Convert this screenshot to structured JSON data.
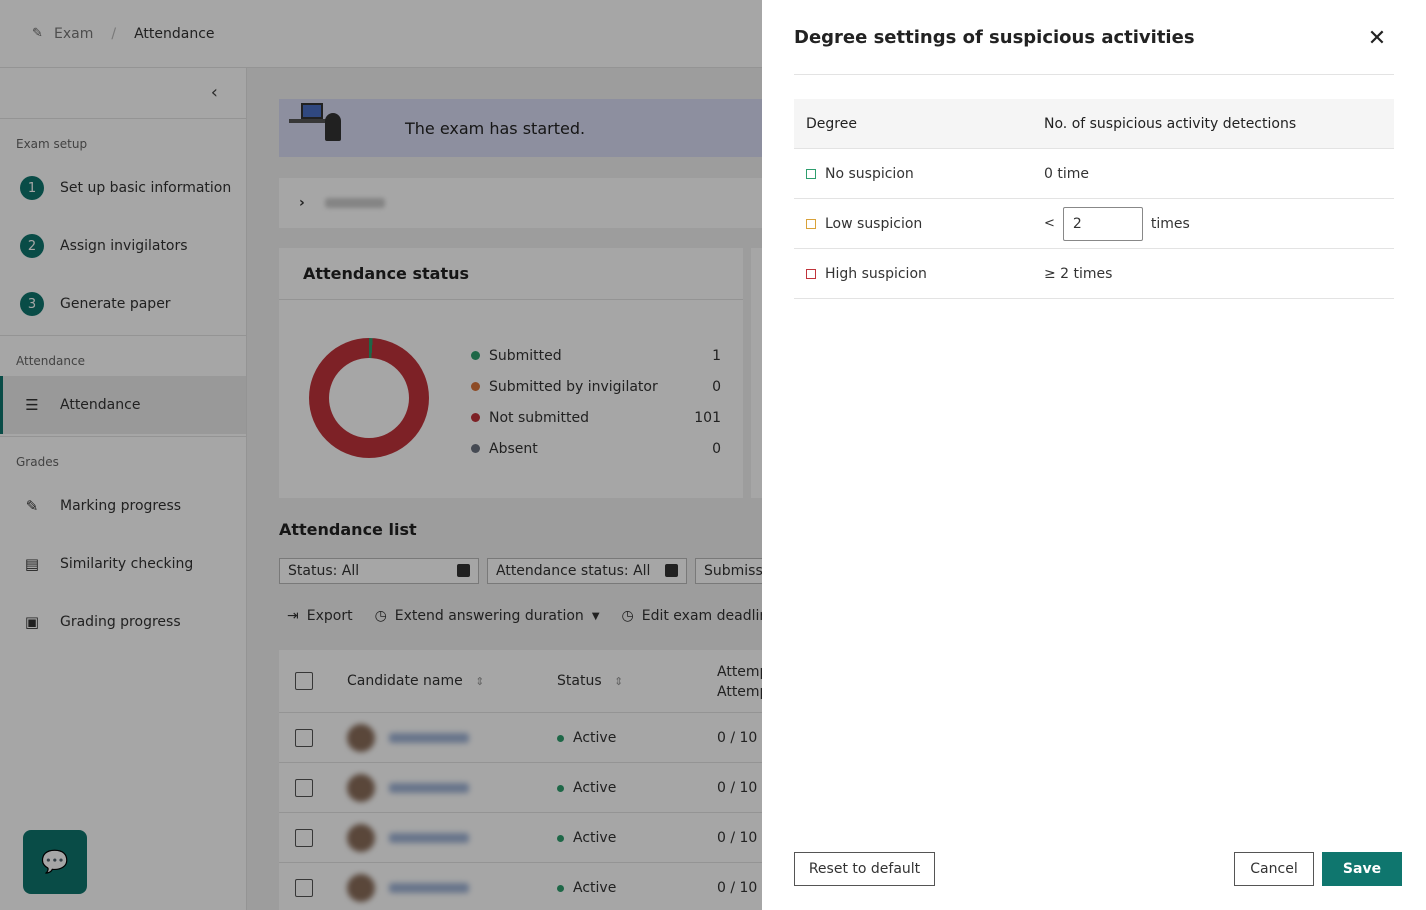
{
  "breadcrumb": {
    "first": "Exam",
    "current": "Attendance",
    "separator": "/"
  },
  "sidebar": {
    "sections": [
      {
        "label": "Exam setup"
      },
      {
        "label": "Attendance"
      },
      {
        "label": "Grades"
      }
    ],
    "setup_items": [
      {
        "num": "1",
        "label": "Set up basic information"
      },
      {
        "num": "2",
        "label": "Assign invigilators"
      },
      {
        "num": "3",
        "label": "Generate paper"
      }
    ],
    "attendance_item": {
      "label": "Attendance",
      "icon": "list-icon"
    },
    "grade_items": [
      {
        "label": "Marking progress",
        "icon": "pencil-icon"
      },
      {
        "label": "Similarity checking",
        "icon": "clipboard-icon"
      },
      {
        "label": "Grading progress",
        "icon": "grade-document-icon"
      }
    ]
  },
  "banner": {
    "text": "The exam has started."
  },
  "attendance_status": {
    "title": "Attendance status",
    "legend": [
      {
        "label": "Submitted",
        "value": "1",
        "color": "#2e9e6e"
      },
      {
        "label": "Submitted by invigilator",
        "value": "0",
        "color": "#d9733a"
      },
      {
        "label": "Not submitted",
        "value": "101",
        "color": "#c0343b"
      },
      {
        "label": "Absent",
        "value": "0",
        "color": "#6b7280"
      }
    ]
  },
  "attendance_list": {
    "title": "Attendance list",
    "filters": [
      "Status: All",
      "Attendance status: All",
      "Submissi"
    ],
    "toolbar": [
      "Export",
      "Extend answering duration",
      "Edit exam deadline"
    ],
    "columns": {
      "name": "Candidate name",
      "status": "Status",
      "attempts_line1": "Attemp",
      "attempts_line2": "Attemp"
    },
    "rows": [
      {
        "status": "Active",
        "attempts": "0 / 10"
      },
      {
        "status": "Active",
        "attempts": "0 / 10"
      },
      {
        "status": "Active",
        "attempts": "0 / 10"
      },
      {
        "status": "Active",
        "attempts": "0 / 10"
      }
    ]
  },
  "drawer": {
    "title": "Degree settings of suspicious activities",
    "columns": {
      "degree": "Degree",
      "detections": "No. of suspicious activity detections"
    },
    "rows": {
      "none": {
        "label": "No suspicion",
        "value": "0 time",
        "color": "#2e9e6e"
      },
      "low": {
        "label": "Low suspicion",
        "prefix": "<",
        "input_value": "2",
        "unit": "times",
        "color": "#d9a23a"
      },
      "high": {
        "label": "High suspicion",
        "value": "≥ 2 times",
        "color": "#c0343b"
      }
    },
    "buttons": {
      "reset": "Reset to default",
      "cancel": "Cancel",
      "save": "Save"
    }
  },
  "colors": {
    "accent": "#0f766e"
  }
}
